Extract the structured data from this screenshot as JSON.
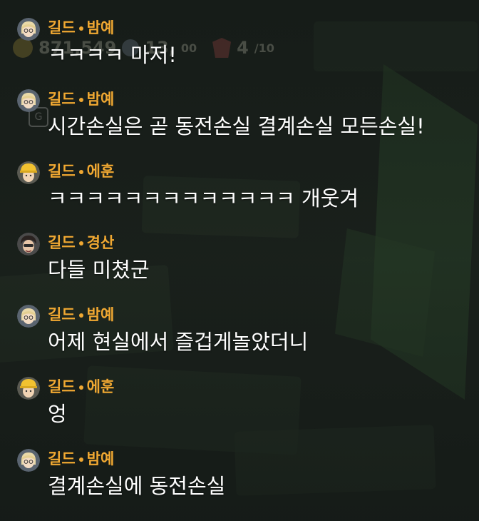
{
  "hud": {
    "coins": "871,549",
    "gems": "13,",
    "gems_suffix": "00",
    "energy": "4",
    "energy_max": "/10",
    "badge_letter": "G"
  },
  "chat": {
    "messages": [
      {
        "prefix": "길드",
        "name": "밤예",
        "text": "ㅋㅋㅋㅋ 마저!",
        "avatar": "blonde"
      },
      {
        "prefix": "길드",
        "name": "밤예",
        "text": "시간손실은 곧 동전손실 결계손실 모든손실!",
        "avatar": "blonde"
      },
      {
        "prefix": "길드",
        "name": "에훈",
        "text": "ㅋㅋㅋㅋㅋㅋㅋㅋㅋㅋㅋㅋㅋ 개웃겨",
        "avatar": "helmet"
      },
      {
        "prefix": "길드",
        "name": "경산",
        "text": "다들 미쳤군",
        "avatar": "dark"
      },
      {
        "prefix": "길드",
        "name": "밤예",
        "text": "어제 현실에서 즐겁게놀았더니",
        "avatar": "blonde"
      },
      {
        "prefix": "길드",
        "name": "에훈",
        "text": "엉",
        "avatar": "helmet"
      },
      {
        "prefix": "길드",
        "name": "밤예",
        "text": "결계손실에 동전손실",
        "avatar": "blonde"
      }
    ]
  }
}
